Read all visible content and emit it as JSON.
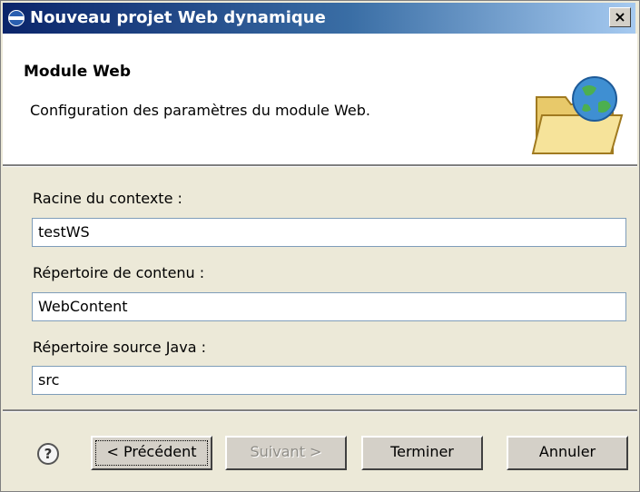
{
  "window": {
    "title": "Nouveau projet Web dynamique",
    "close_label": "×"
  },
  "header": {
    "title": "Module Web",
    "description": "Configuration des paramètres du module Web."
  },
  "form": {
    "context_root": {
      "label": "Racine du contexte :",
      "value": "testWS"
    },
    "content_dir": {
      "label": "Répertoire de contenu :",
      "value": "WebContent"
    },
    "java_source": {
      "label": "Répertoire source Java :",
      "value": "src"
    }
  },
  "buttons": {
    "help": "?",
    "back": "< Précédent",
    "next": "Suivant >",
    "finish": "Terminer",
    "cancel": "Annuler"
  },
  "icons": {
    "title": "globe-icon",
    "header": "folder-globe-icon"
  }
}
